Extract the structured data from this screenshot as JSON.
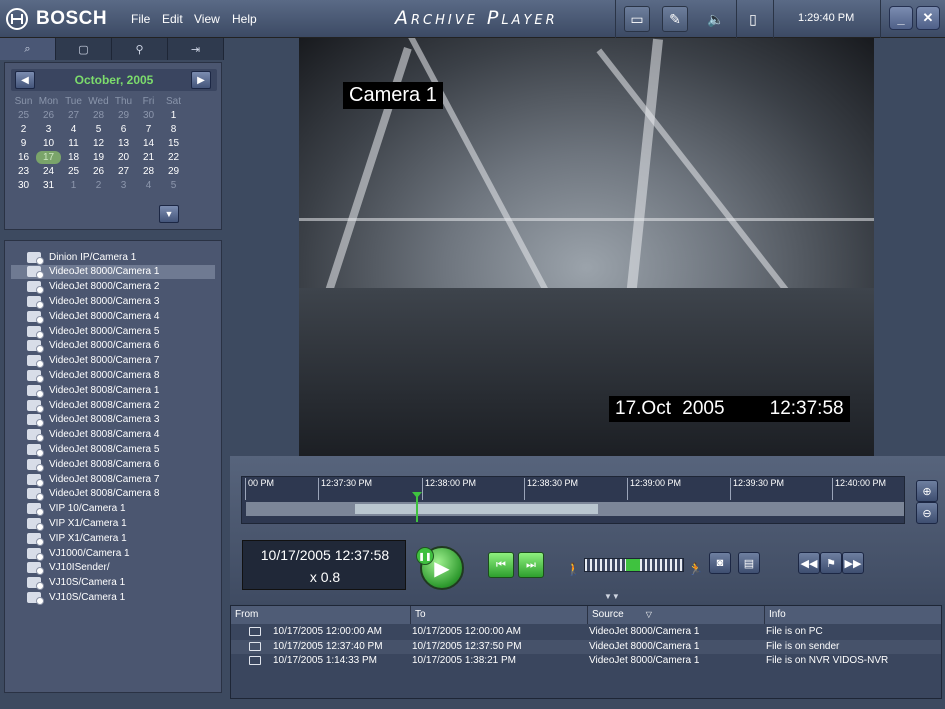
{
  "app": {
    "brand": "BOSCH",
    "title": "Archive Player",
    "clock": "1:29:40 PM"
  },
  "menu": [
    "File",
    "Edit",
    "View",
    "Help"
  ],
  "calendar": {
    "month": "October, 2005",
    "days_header": [
      "Sun",
      "Mon",
      "Tue",
      "Wed",
      "Thu",
      "Fri",
      "Sat"
    ],
    "weeks": [
      [
        "25",
        "26",
        "27",
        "28",
        "29",
        "30",
        "1"
      ],
      [
        "2",
        "3",
        "4",
        "5",
        "6",
        "7",
        "8"
      ],
      [
        "9",
        "10",
        "11",
        "12",
        "13",
        "14",
        "15"
      ],
      [
        "16",
        "17",
        "18",
        "19",
        "20",
        "21",
        "22"
      ],
      [
        "23",
        "24",
        "25",
        "26",
        "27",
        "28",
        "29"
      ],
      [
        "30",
        "31",
        "1",
        "2",
        "3",
        "4",
        "5"
      ]
    ],
    "selected_day": "17"
  },
  "cameras": [
    "Dinion IP/Camera 1",
    "VideoJet 8000/Camera 1",
    "VideoJet 8000/Camera 2",
    "VideoJet 8000/Camera 3",
    "VideoJet 8000/Camera 4",
    "VideoJet 8000/Camera 5",
    "VideoJet 8000/Camera 6",
    "VideoJet 8000/Camera 7",
    "VideoJet 8000/Camera 8",
    "VideoJet 8008/Camera 1",
    "VideoJet 8008/Camera 2",
    "VideoJet 8008/Camera 3",
    "VideoJet 8008/Camera 4",
    "VideoJet 8008/Camera 5",
    "VideoJet 8008/Camera 6",
    "VideoJet 8008/Camera 7",
    "VideoJet 8008/Camera 8",
    "VIP 10/Camera 1",
    "VIP X1/Camera 1",
    "VIP X1/Camera 1",
    "VJ1000/Camera 1",
    "VJ10ISender/",
    "VJ10S/Camera 1",
    "VJ10S/Camera 1"
  ],
  "selected_camera": "VideoJet 8000/Camera 1",
  "video": {
    "overlay_camera": "Camera 1",
    "overlay_timestamp": "17.Oct 2005    12:37:58"
  },
  "timeline": {
    "ticks": [
      "00 PM",
      "12:37:30 PM",
      "12:38:00 PM",
      "12:38:30 PM",
      "12:39:00 PM",
      "12:39:30 PM",
      "12:40:00 PM"
    ]
  },
  "playback": {
    "current_time": "10/17/2005 12:37:58",
    "speed": "x 0.8"
  },
  "table": {
    "headers": [
      "From",
      "To",
      "Source",
      "Info"
    ],
    "rows": [
      {
        "from": "10/17/2005 12:00:00 AM",
        "to": "10/17/2005 12:00:00 AM",
        "source": "VideoJet 8000/Camera 1",
        "info": "File is on PC"
      },
      {
        "from": "10/17/2005 12:37:40 PM",
        "to": "10/17/2005 12:37:50 PM",
        "source": "VideoJet 8000/Camera 1",
        "info": "File is on sender"
      },
      {
        "from": "10/17/2005 1:14:33 PM",
        "to": "10/17/2005 1:38:21 PM",
        "source": "VideoJet 8000/Camera 1",
        "info": "File is on NVR VIDOS-NVR"
      }
    ]
  },
  "colors": {
    "accent_green": "#3fc23f",
    "calendar_month": "#7cdc6c",
    "panel": "#4b5670"
  }
}
